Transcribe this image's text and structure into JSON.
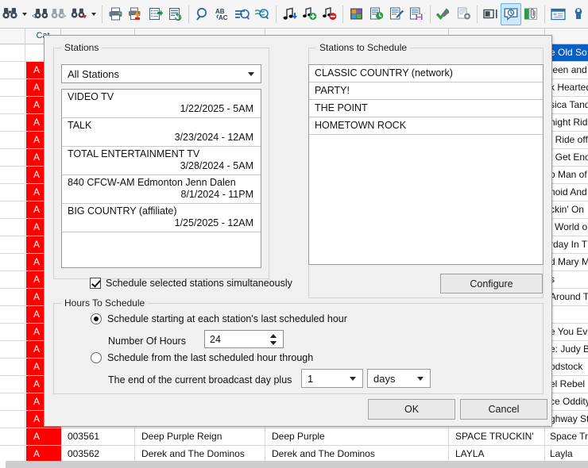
{
  "toolbar": {
    "icons": [
      {
        "name": "find-icon",
        "glyph": "binoculars"
      },
      {
        "name": "find-dropdown-caret",
        "glyph": "caret"
      },
      {
        "name": "find-previous-icon",
        "glyph": "binoculars-back"
      },
      {
        "name": "find-next-icon",
        "glyph": "binoculars-forward"
      },
      {
        "name": "find-favorite-icon",
        "glyph": "binoculars-heart"
      },
      {
        "name": "find-favorite-caret",
        "glyph": "caret"
      },
      {
        "name": "separator-1",
        "glyph": "sep"
      },
      {
        "name": "print-icon",
        "glyph": "printer"
      },
      {
        "name": "quick-print-icon",
        "glyph": "printer-bolt"
      },
      {
        "name": "export-list-icon",
        "glyph": "list-export"
      },
      {
        "name": "refresh-list-icon",
        "glyph": "list-refresh"
      },
      {
        "name": "separator-2",
        "glyph": "sep"
      },
      {
        "name": "search-icon",
        "glyph": "magnifier"
      },
      {
        "name": "replace-icon",
        "glyph": "ab-ac"
      },
      {
        "name": "filter-icon",
        "glyph": "filter"
      },
      {
        "name": "approximate-filter-icon",
        "glyph": "filter-approx"
      },
      {
        "name": "separator-3",
        "glyph": "sep"
      },
      {
        "name": "song-import-icon",
        "glyph": "note-down"
      },
      {
        "name": "song-add-icon",
        "glyph": "note-plus"
      },
      {
        "name": "song-delete-icon",
        "glyph": "note-minus"
      },
      {
        "name": "separator-4",
        "glyph": "sep"
      },
      {
        "name": "categories-icon",
        "glyph": "color-grid"
      },
      {
        "name": "clock-editor-icon",
        "glyph": "doc-clock"
      },
      {
        "name": "edit-log-icon",
        "glyph": "doc-pen"
      },
      {
        "name": "save-log-icon",
        "glyph": "doc-save"
      },
      {
        "name": "separator-5",
        "glyph": "sep"
      },
      {
        "name": "verify-icon",
        "glyph": "check-wrench"
      },
      {
        "name": "document-settings-icon",
        "glyph": "doc-gear"
      },
      {
        "name": "separator-6",
        "glyph": "sep"
      },
      {
        "name": "panel-toggle-icon",
        "glyph": "panel"
      },
      {
        "name": "schedule-icon",
        "glyph": "balloon-clock"
      },
      {
        "name": "attachment-icon",
        "glyph": "clip-green"
      },
      {
        "name": "separator-7",
        "glyph": "sep"
      },
      {
        "name": "library-icon",
        "glyph": "window-list"
      },
      {
        "name": "tools-icon",
        "glyph": "wrench"
      }
    ]
  },
  "grid": {
    "headers": [
      {
        "label": "",
        "key": "select"
      },
      {
        "label": "Cat",
        "key": "cat"
      },
      {
        "label": "",
        "key": "id"
      },
      {
        "label": "",
        "key": "title1"
      },
      {
        "label": "",
        "key": "artist"
      },
      {
        "label": "",
        "key": "title_caps"
      },
      {
        "label": "",
        "key": "title_mixed"
      }
    ],
    "right_column_values": [
      "e Old So",
      "teen and",
      "k Hearted",
      "sica Tandy",
      "night Rid",
      ": Ride off",
      "t Get Eno",
      "o Man of",
      "noid And",
      "ckin' On",
      "l World o",
      "rday In T",
      "d Mary M",
      "s",
      "Around Th",
      "",
      "e You Eve",
      "e: Judy Bl",
      "odstock",
      "el Rebel",
      "ce Oddity",
      "ghway Star"
    ],
    "bottom_rows": [
      {
        "cat": "A",
        "id": "003561",
        "title1": "Deep Purple Reign",
        "artist": "Deep Purple",
        "title_caps": "SPACE TRUCKIN'",
        "title_mixed": "Space Trucki"
      },
      {
        "cat": "A",
        "id": "003562",
        "title1": "Derek and The Dominos",
        "artist": "Derek and The Dominos",
        "title_caps": "LAYLA",
        "title_mixed": "Layla"
      }
    ],
    "cat_value": "A"
  },
  "dialog": {
    "stations_group": {
      "title": "Stations",
      "filter_value": "All Stations",
      "stations": [
        {
          "name": "VIDEO TV",
          "date": "1/22/2025 - 5AM"
        },
        {
          "name": "TALK",
          "date": "3/23/2024 - 12AM"
        },
        {
          "name": "TOTAL ENTERTAINMENT TV",
          "date": "3/28/2024 - 5AM"
        },
        {
          "name": "840 CFCW-AM Edmonton Jenn Dalen",
          "date": "8/1/2024 - 11PM"
        },
        {
          "name": "BIG COUNTRY (affiliate)",
          "date": "1/25/2025 - 12AM"
        }
      ]
    },
    "transfer_buttons": [
      {
        "name": "move-right-button",
        "label": ">"
      },
      {
        "name": "move-all-right-button",
        "label": "> >"
      },
      {
        "name": "move-all-left-button",
        "label": "< <"
      },
      {
        "name": "move-left-button",
        "label": "<"
      }
    ],
    "schedule_group": {
      "title": "Stations to Schedule",
      "stations": [
        "CLASSIC COUNTRY (network)",
        "PARTY!",
        "THE POINT",
        "HOMETOWN ROCK"
      ],
      "configure_label": "Configure"
    },
    "simultaneous_checkbox": {
      "label": "Schedule selected stations simultaneously",
      "checked": true
    },
    "hours_group": {
      "title": "Hours To Schedule",
      "option_last_hour": {
        "label": "Schedule starting at each station's last scheduled hour",
        "selected": true
      },
      "number_of_hours_label": "Number Of Hours",
      "number_of_hours_value": "24",
      "option_through": {
        "label": "Schedule from the last scheduled hour through",
        "selected": false
      },
      "broadcast_day_label": "The end of the current broadcast day plus",
      "broadcast_day_amount": "1",
      "broadcast_day_unit": "days"
    },
    "ok_label": "OK",
    "cancel_label": "Cancel"
  }
}
